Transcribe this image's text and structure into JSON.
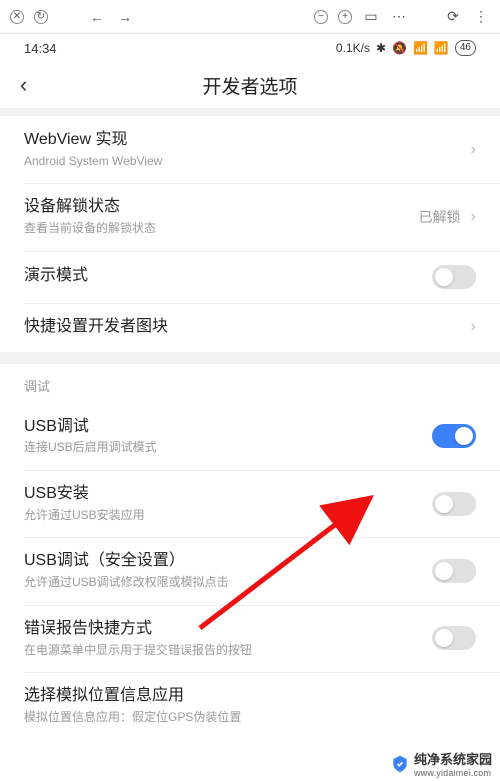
{
  "chrome": {
    "close_icon": "✕",
    "refresh_icon": "↻",
    "back_icon": "←",
    "fwd_icon": "→",
    "zoom_out": "−",
    "zoom_in": "+",
    "reader_icon": "▭",
    "menu_icon": "⋯",
    "rotate_icon": "⟳",
    "overflow_icon": "⋮"
  },
  "statusbar": {
    "time": "14:34",
    "net": "0.1K/s",
    "bt": "✱",
    "mute": "🔇",
    "sig": "📶",
    "wifi": "≋",
    "batt": "46"
  },
  "page": {
    "back": "‹",
    "title": "开发者选项"
  },
  "rows": {
    "webview": {
      "label": "WebView 实现",
      "sub": "Android System WebView"
    },
    "unlock": {
      "label": "设备解锁状态",
      "sub": "查看当前设备的解锁状态",
      "value": "已解锁"
    },
    "demo": {
      "label": "演示模式"
    },
    "tiles": {
      "label": "快捷设置开发者图块"
    },
    "section_debug": "调试",
    "usb_debug": {
      "label": "USB调试",
      "sub": "连接USB后启用调试模式"
    },
    "usb_install": {
      "label": "USB安装",
      "sub": "允许通过USB安装应用"
    },
    "usb_sec": {
      "label": "USB调试（安全设置）",
      "sub": "允许通过USB调试修改权限或模拟点击"
    },
    "bugreport": {
      "label": "错误报告快捷方式",
      "sub": "在电源菜单中显示用于提交错误报告的按钮"
    },
    "mocklocation": {
      "label": "选择模拟位置信息应用",
      "sub": "模拟位置信息应用：假定位GPS伪装位置"
    }
  },
  "watermark": {
    "brand": "纯净系统家园",
    "url": "www.yidaimei.com"
  }
}
